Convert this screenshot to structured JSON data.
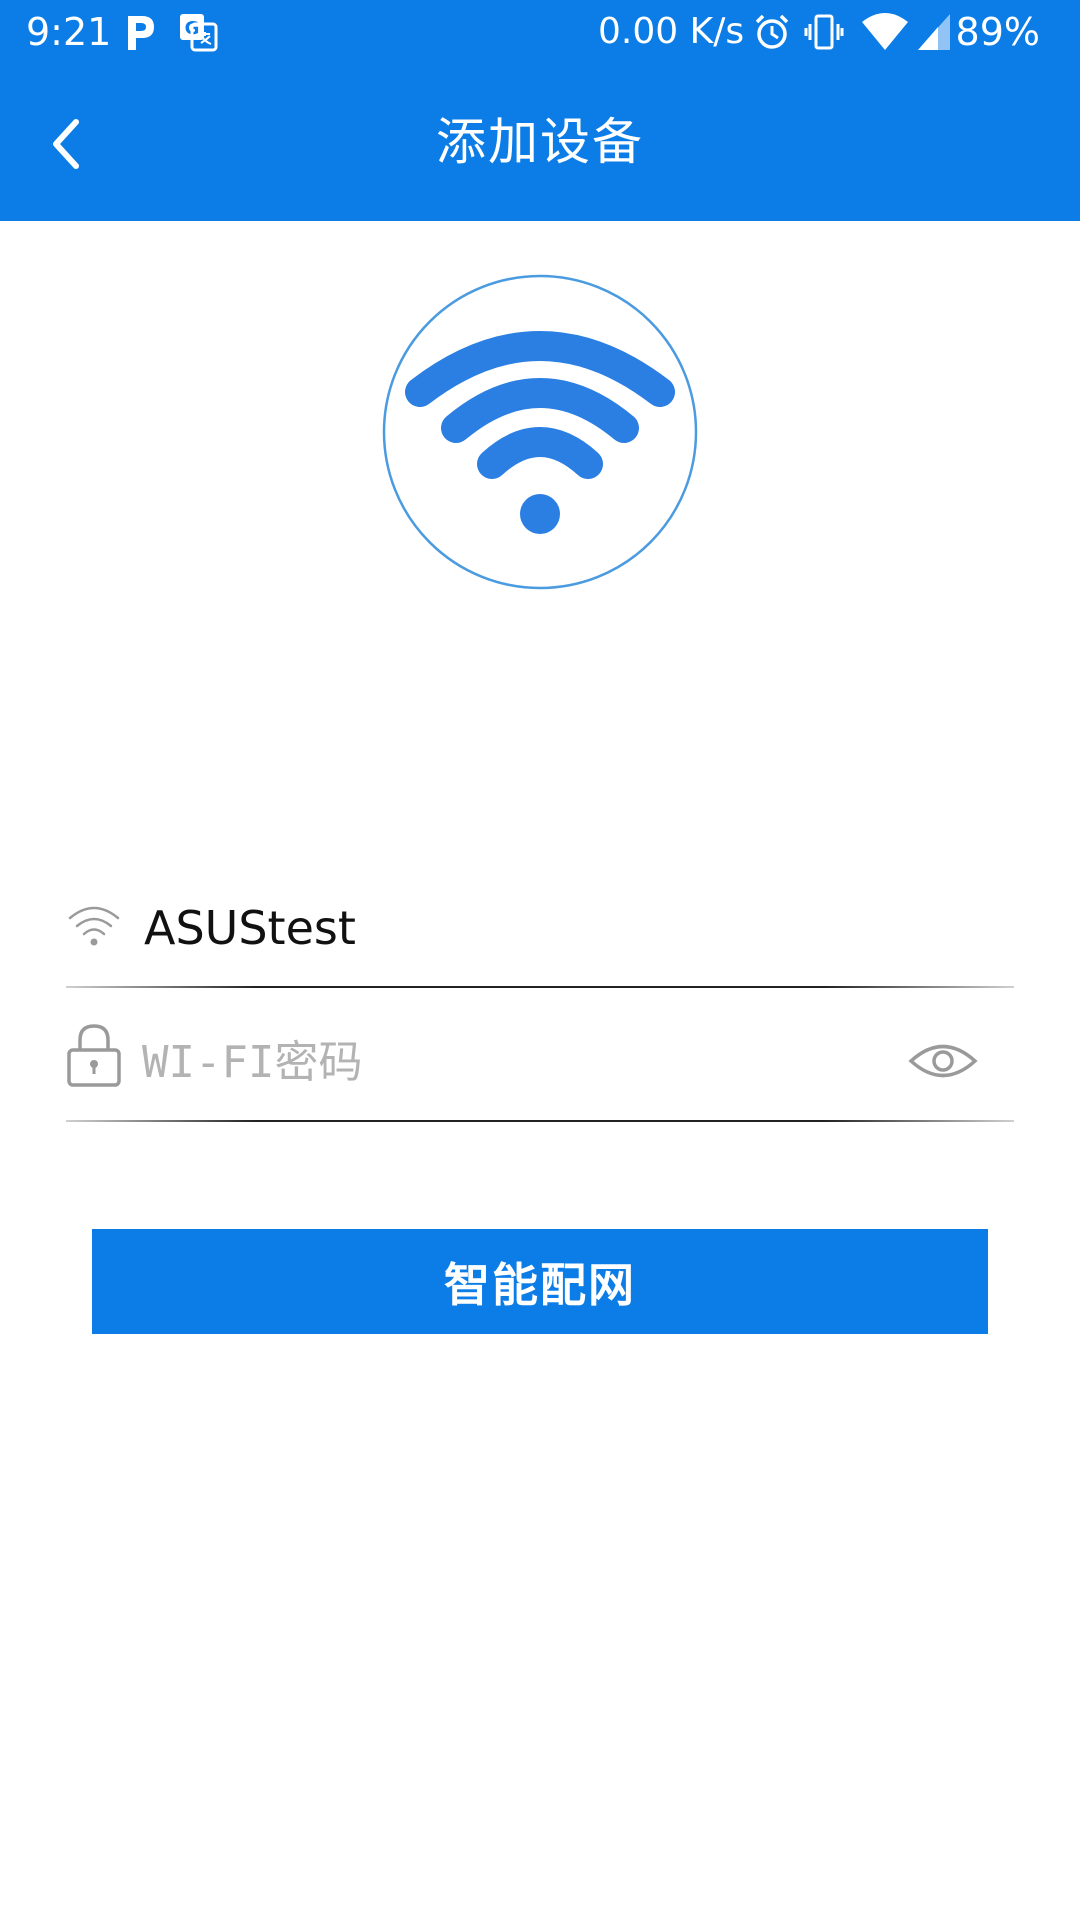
{
  "status_bar": {
    "time": "9:21",
    "network_speed": "0.00 K/s",
    "battery": "89%",
    "icons": [
      "p-app-icon",
      "translate-icon",
      "alarm-icon",
      "vibrate-icon",
      "wifi-signal-icon",
      "cell-signal-icon"
    ]
  },
  "header": {
    "title": "添加设备",
    "back_icon": "chevron-left-icon"
  },
  "hero": {
    "icon": "wifi-icon"
  },
  "form": {
    "ssid_icon": "wifi-icon",
    "ssid_value": "ASUStest",
    "password_icon": "lock-icon",
    "password_placeholder": "WI-FI密码",
    "password_value": "",
    "visibility_icon": "eye-icon"
  },
  "actions": {
    "connect_label": "智能配网"
  },
  "colors": {
    "primary": "#0c7de7",
    "wifi_blue": "#2b7fe3",
    "hero_ring": "#4a9be0",
    "placeholder": "#b3b3b3",
    "icon_gray": "#9a9a9a"
  }
}
